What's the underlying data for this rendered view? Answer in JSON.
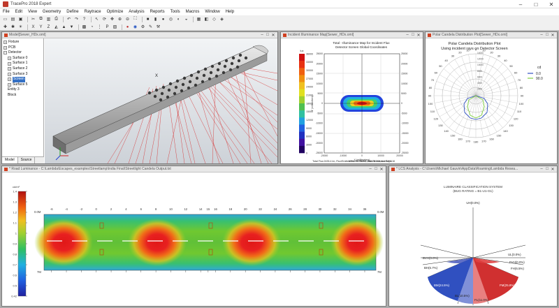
{
  "app": {
    "title": "TracePro 2018 Expert",
    "menu": [
      "File",
      "Edit",
      "View",
      "Geometry",
      "Define",
      "Raytrace",
      "Optimize",
      "Analysis",
      "Reports",
      "Tools",
      "Macros",
      "Window",
      "Help"
    ]
  },
  "model_window": {
    "title": "Model[Sewer_HDx.oml]",
    "tree": [
      {
        "label": "Fixture",
        "level": 1
      },
      {
        "label": "PCB",
        "level": 1
      },
      {
        "label": "Detector",
        "level": 1
      },
      {
        "label": "Surface 0",
        "level": 2
      },
      {
        "label": "Surface 1",
        "level": 2
      },
      {
        "label": "Surface 2",
        "level": 2
      },
      {
        "label": "Surface 3",
        "level": 2
      },
      {
        "label": "Screen",
        "level": 2,
        "selected": true
      },
      {
        "label": "Surface 5",
        "level": 2
      },
      {
        "label": "Entity 3",
        "level": 1
      },
      {
        "label": "Block",
        "level": 1
      }
    ],
    "tabs": [
      "Model",
      "Source"
    ],
    "axis_label": "X"
  },
  "irradiance_window": {
    "title": "Incident Illuminance Map[Sewer_HDx.oml]",
    "heading1": "Total - Illuminance Map for Incident Flux",
    "heading2": "Detector Screen    Global Coordinates",
    "colorbar_unit": "lux",
    "colorbar_ticks": [
      "36000",
      "33000",
      "30000",
      "27000",
      "24000",
      "21000",
      "18000",
      "15000",
      "12000",
      "9000",
      "6000",
      "3000",
      "0"
    ],
    "y_left_ticks": [
      "25000",
      "20000",
      "15000",
      "10000",
      "5000",
      "0",
      "-5000",
      "-10000",
      "-15000",
      "-20000",
      "-25000"
    ],
    "y_right_ticks": [
      "25000",
      "20000",
      "15000",
      "10000",
      "5000",
      "0",
      "-5000",
      "-10000",
      "-15000",
      "-20000",
      "-25000"
    ],
    "x_ticks": [
      "-20000",
      "-10000",
      "0",
      "10000",
      "20000"
    ],
    "xlabel": "X (millimeters)",
    "ylabel": "Y (millimeters)",
    "footer1": "Min:2.7507e-005, Max:38.205, Ave:0.97418",
    "footer2": "Total Flux:2435.4 lm, Flux/Emitted Flux:0.70693, 284378 Incident Rays"
  },
  "polar_window": {
    "title": "Polar Candela Distribution Plot[Sewer_HDx.oml]",
    "heading1": "Polar Candela Distribution Plot",
    "heading2": "Using incident rays on Detector Screen",
    "legend_unit": "cd",
    "legend": [
      {
        "label": "0.0",
        "color": "#3050c0"
      },
      {
        "label": "90.0",
        "color": "#80d040"
      }
    ],
    "angle_labels": [
      "180",
      "170",
      "160",
      "150",
      "140",
      "130",
      "120",
      "110",
      "100",
      "90",
      "80",
      "70",
      "60",
      "50",
      "40",
      "30",
      "20",
      "10",
      "0"
    ],
    "radial_labels": [
      "14000",
      "12000",
      "10000",
      "8000",
      "6000",
      "4000",
      "2000"
    ]
  },
  "road_window": {
    "title": "* Road Luminance - C:\\Lambda\\Escapes_examples\\Streetlamp\\India Final\\Streetlight Candela Output.txt",
    "scale_unit": "cd/m²",
    "scale_ticks": [
      "1.4",
      "1.3",
      "1.2",
      "1.1",
      "1",
      "0.9",
      "0.8",
      "0.7",
      "0.6",
      "0.5",
      "0.42"
    ],
    "x_ticks": [
      "-6",
      "-4",
      "-2",
      "0",
      "2",
      "4",
      "6",
      "8",
      "10",
      "12",
      "14",
      "15",
      "16",
      "18",
      "20",
      "22",
      "24",
      "26",
      "28",
      "30",
      "32",
      "34",
      "36"
    ],
    "left_labels": [
      "0.0M",
      "7M"
    ],
    "right_labels": [
      "0.0M",
      "7M"
    ]
  },
  "lcs_window": {
    "title": "* LCS Analysis - C:\\Users\\Michael Gauvin\\AppData\\Roaming\\Lambda Resea...",
    "heading1": "LUMINAIRE CLASSIFICATION SYSTEM",
    "heading2": "(BUG RATING = B1-U1-G1)",
    "zones": {
      "UH": "UH(0.0%)",
      "BVH": "BVH(0.0%)",
      "UL": "UL(0.0%)",
      "FVH": "FVH(0.0%)",
      "BH": "BH(6.7%)",
      "FH": "FH(6.5%)",
      "BM": "BM(24.5%)",
      "FM": "FM(25.8%)",
      "BL": "BL(10.5%)",
      "FL": "FL(11.0%)"
    }
  }
}
